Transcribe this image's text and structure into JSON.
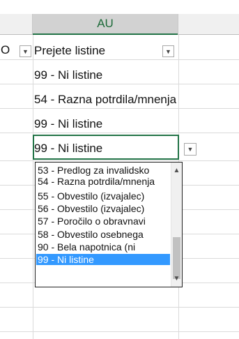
{
  "spreadsheet": {
    "column_header": "AU",
    "prev_column_fragment": "O",
    "header_cell_label": "Prejete listine",
    "cells": [
      "99 - Ni listine",
      "54 -  Razna potrdila/mnenja",
      "99 - Ni listine"
    ],
    "active_cell_value": "99 - Ni listine"
  },
  "dropdown": {
    "options": [
      "53 -  Predlog za invalidsko",
      "54 -  Razna potrdila/mnenja",
      "55 -  Obvestilo (izvajalec)",
      "56 -  Obvestilo (izvajalec)",
      "57 - Poročilo o obravnavi",
      "58 - Obvestilo osebnega",
      "90 - Bela napotnica (ni",
      "99 - Ni listine"
    ],
    "selected": "99 - Ni listine"
  },
  "colors": {
    "accent": "#217346",
    "selection": "#3399ff"
  }
}
